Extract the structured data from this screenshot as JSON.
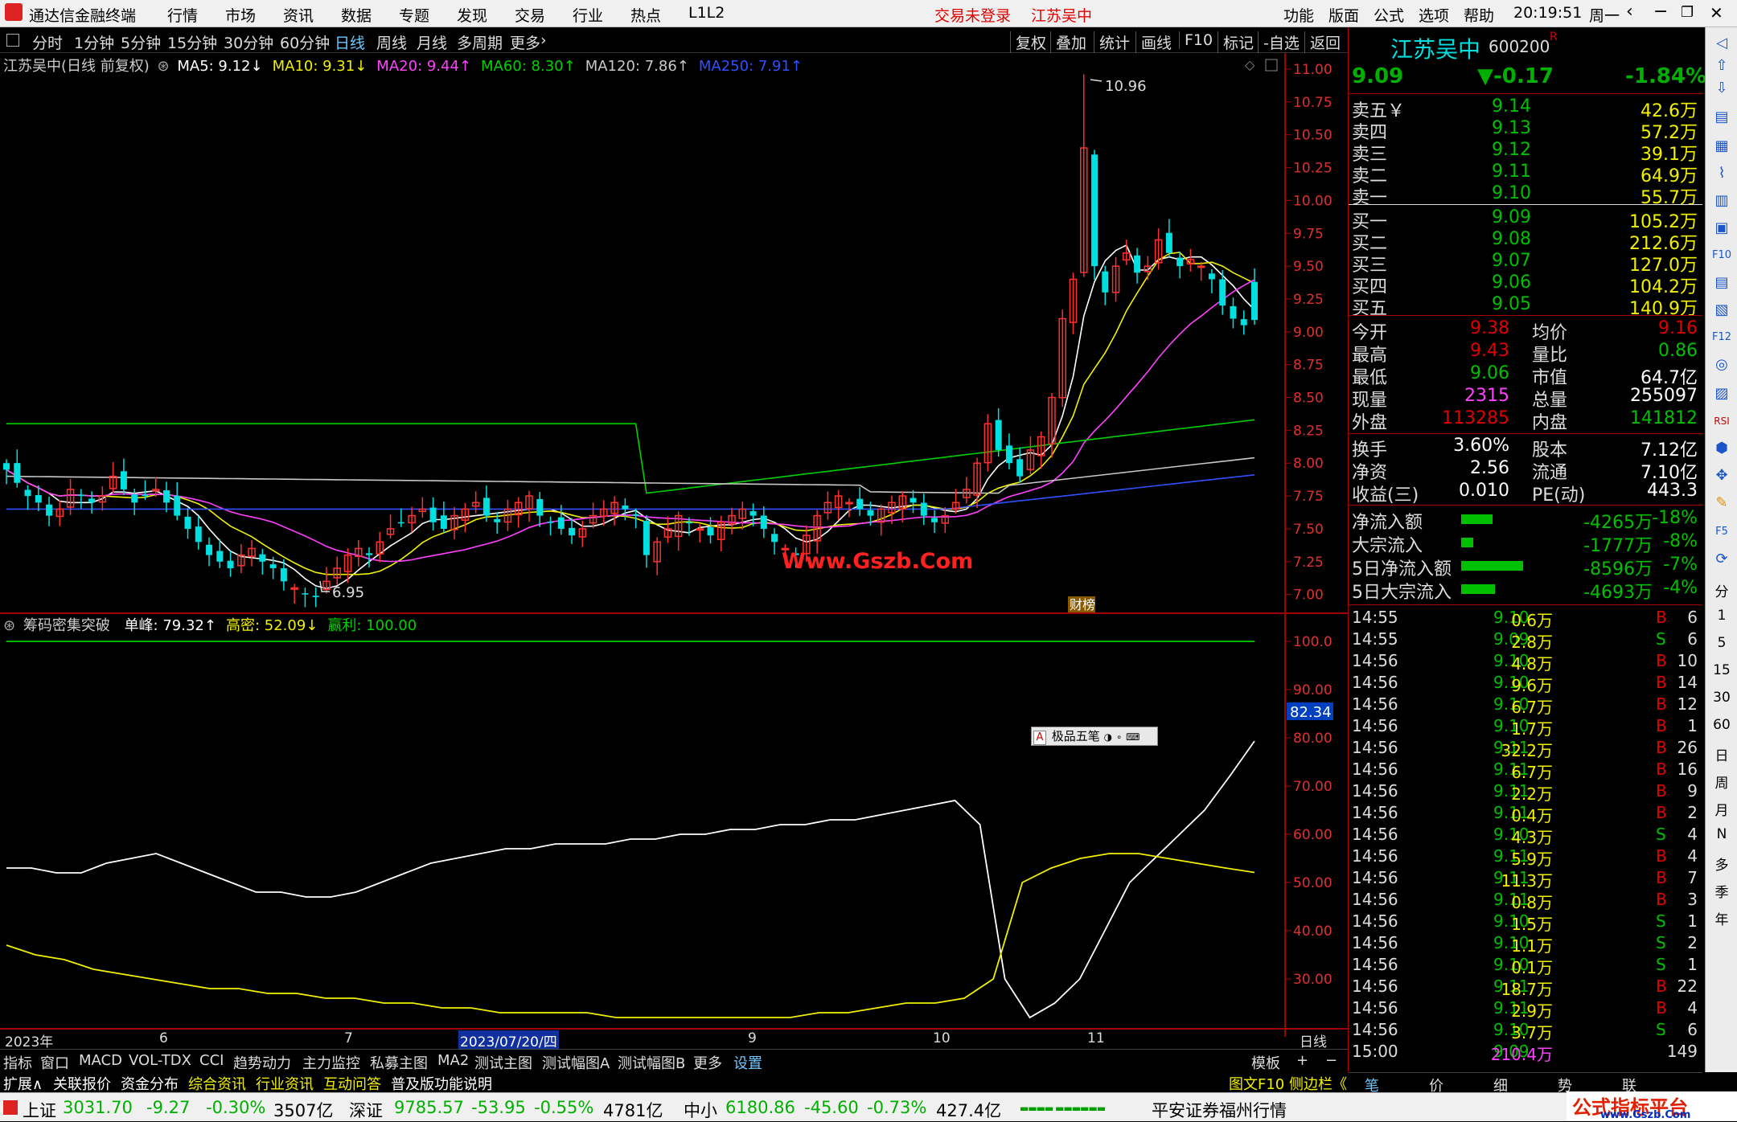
{
  "menubar": {
    "app_title": "通达信金融终端",
    "menus": [
      "行情",
      "市场",
      "资讯",
      "数据",
      "专题",
      "发现",
      "交易",
      "行业",
      "热点",
      "L1L2"
    ],
    "trade_status": "交易未登录",
    "stock_name": "江苏吴中",
    "right_menus": [
      "功能",
      "版面",
      "公式",
      "选项",
      "帮助"
    ],
    "time": "20:19:51",
    "weekday": "周一"
  },
  "period_bar": {
    "periods": [
      "分时",
      "1分钟",
      "5分钟",
      "15分钟",
      "30分钟",
      "60分钟",
      "日线",
      "周线",
      "月线",
      "多周期",
      "更多"
    ],
    "selected": "日线",
    "tools": [
      "复权",
      "叠加",
      "统计",
      "画线",
      "F10",
      "标记",
      "-自选",
      "返回"
    ]
  },
  "main_chart": {
    "title": "江苏吴中(日线 前复权)",
    "ma_labels": [
      {
        "text": "MA5: 9.12↓",
        "color": "#ffffff"
      },
      {
        "text": "MA10: 9.31↓",
        "color": "#f0f000"
      },
      {
        "text": "MA20: 9.44↑",
        "color": "#ff40ff"
      },
      {
        "text": "MA60: 8.30↑",
        "color": "#00d000"
      },
      {
        "text": "MA120: 7.86↑",
        "color": "#c8c8c8"
      },
      {
        "text": "MA250: 7.91↑",
        "color": "#3050ff"
      }
    ],
    "high_label": "10.96",
    "low_label": "6.95",
    "watermark": "Www.Gszb.Com",
    "caibang_label": "财榜",
    "y_ticks": [
      "11.00",
      "10.75",
      "10.50",
      "10.25",
      "10.00",
      "9.75",
      "9.50",
      "9.25",
      "9.00",
      "8.75",
      "8.50",
      "8.25",
      "8.00",
      "7.75",
      "7.50",
      "7.25",
      "7.00"
    ]
  },
  "indicator": {
    "name": "筹码密集突破",
    "labels": [
      {
        "text": "单峰: 79.32↑",
        "color": "#ffffff"
      },
      {
        "text": "高密: 52.09↓",
        "color": "#f0f000"
      },
      {
        "text": "赢利: 100.00",
        "color": "#00d000"
      }
    ],
    "current_value": "82.34",
    "ime_text": "极品五笔",
    "y_ticks": [
      "100.0",
      "90.00",
      "80.00",
      "70.00",
      "60.00",
      "50.00",
      "40.00",
      "30.00"
    ]
  },
  "x_axis": {
    "labels": [
      "2023年",
      "6",
      "7",
      "2023/07/20/四",
      "9",
      "10",
      "11"
    ],
    "right_label": "日线"
  },
  "chart_data": [
    {
      "type": "candlestick",
      "title": "江苏吴中(日线 前复权)",
      "x_range": [
        "2023-05",
        "2023-11"
      ],
      "ylim": [
        6.9,
        11.0
      ],
      "annotations": [
        {
          "label": "10.96",
          "kind": "high"
        },
        {
          "label": "6.95",
          "kind": "low"
        }
      ],
      "close_approx": [
        7.95,
        7.85,
        7.75,
        7.7,
        7.6,
        7.65,
        7.8,
        7.75,
        7.7,
        7.75,
        7.9,
        7.8,
        7.7,
        7.75,
        7.8,
        7.7,
        7.6,
        7.5,
        7.4,
        7.3,
        7.25,
        7.2,
        7.3,
        7.35,
        7.25,
        7.2,
        7.1,
        7.05,
        7.0,
        6.98,
        7.1,
        7.2,
        7.3,
        7.35,
        7.3,
        7.4,
        7.5,
        7.55,
        7.6,
        7.65,
        7.55,
        7.5,
        7.6,
        7.65,
        7.7,
        7.6,
        7.55,
        7.65,
        7.7,
        7.75,
        7.6,
        7.55,
        7.5,
        7.45,
        7.5,
        7.6,
        7.65,
        7.7,
        7.65,
        7.6,
        7.3,
        7.4,
        7.5,
        7.6,
        7.55,
        7.5,
        7.45,
        7.55,
        7.6,
        7.65,
        7.6,
        7.5,
        7.4,
        7.35,
        7.3,
        7.45,
        7.6,
        7.7,
        7.75,
        7.7,
        7.65,
        7.6,
        7.65,
        7.7,
        7.75,
        7.7,
        7.6,
        7.55,
        7.6,
        7.7,
        7.8,
        8.0,
        8.3,
        8.1,
        8.0,
        7.9,
        8.1,
        8.2,
        8.5,
        9.1,
        9.4,
        10.4,
        9.5,
        9.3,
        9.5,
        9.6,
        9.45,
        9.5,
        9.7,
        9.6,
        9.5,
        9.55,
        9.5,
        9.4,
        9.2,
        9.1,
        9.05,
        9.09
      ],
      "series": [
        {
          "name": "MA5",
          "last": 9.12
        },
        {
          "name": "MA10",
          "last": 9.31
        },
        {
          "name": "MA20",
          "last": 9.44
        },
        {
          "name": "MA60",
          "last": 8.3
        },
        {
          "name": "MA120",
          "last": 7.86
        },
        {
          "name": "MA250",
          "last": 7.91
        }
      ]
    },
    {
      "type": "line",
      "title": "筹码密集突破",
      "ylim": [
        20,
        102
      ],
      "series": [
        {
          "name": "单峰",
          "last": 79.32,
          "values": [
            53,
            53,
            52,
            52,
            54,
            55,
            56,
            54,
            52,
            50,
            48,
            48,
            47,
            47,
            48,
            50,
            52,
            54,
            55,
            56,
            57,
            57,
            58,
            58,
            58,
            59,
            59,
            60,
            60,
            61,
            61,
            62,
            62,
            63,
            63,
            64,
            65,
            66,
            67,
            62,
            30,
            22,
            25,
            30,
            40,
            50,
            55,
            60,
            65,
            72,
            79.32
          ]
        },
        {
          "name": "高密",
          "last": 52.09,
          "values": [
            37,
            35,
            34,
            32,
            31,
            30,
            29,
            28,
            28,
            27,
            27,
            26,
            26,
            25,
            25,
            24,
            24,
            23,
            23,
            23,
            23,
            22,
            22,
            22,
            22,
            22,
            22,
            22,
            23,
            23,
            24,
            25,
            25,
            26,
            30,
            50,
            53,
            55,
            56,
            56,
            55,
            54,
            53,
            52.09
          ]
        },
        {
          "name": "赢利",
          "last": 100.0,
          "values": [
            100,
            100
          ]
        }
      ]
    }
  ],
  "quote": {
    "name": "江苏吴中",
    "code": "600200",
    "flag": "R",
    "price": "9.09",
    "change": "▼-0.17",
    "pct": "-1.84%",
    "asks": [
      {
        "label": "卖五￥",
        "price": "9.14",
        "vol": "42.6万"
      },
      {
        "label": "卖四",
        "price": "9.13",
        "vol": "57.2万"
      },
      {
        "label": "卖三",
        "price": "9.12",
        "vol": "39.1万"
      },
      {
        "label": "卖二",
        "price": "9.11",
        "vol": "64.9万"
      },
      {
        "label": "卖一",
        "price": "9.10",
        "vol": "55.7万"
      }
    ],
    "bids": [
      {
        "label": "买一",
        "price": "9.09",
        "vol": "105.2万"
      },
      {
        "label": "买二",
        "price": "9.08",
        "vol": "212.6万"
      },
      {
        "label": "买三",
        "price": "9.07",
        "vol": "127.0万"
      },
      {
        "label": "买四",
        "price": "9.06",
        "vol": "104.2万"
      },
      {
        "label": "买五",
        "price": "9.05",
        "vol": "140.9万"
      }
    ],
    "stats": [
      {
        "l1": "今开",
        "v1": "9.38",
        "c1": "#e00000",
        "l2": "均价",
        "v2": "9.16",
        "c2": "#e00000"
      },
      {
        "l1": "最高",
        "v1": "9.43",
        "c1": "#e00000",
        "l2": "量比",
        "v2": "0.86",
        "c2": "#00c000"
      },
      {
        "l1": "最低",
        "v1": "9.06",
        "c1": "#00c000",
        "l2": "市值",
        "v2": "64.7亿",
        "c2": "#ffffff"
      },
      {
        "l1": "现量",
        "v1": "2315",
        "c1": "#ff40ff",
        "l2": "总量",
        "v2": "255097",
        "c2": "#ffffff"
      },
      {
        "l1": "外盘",
        "v1": "113285",
        "c1": "#e00000",
        "l2": "内盘",
        "v2": "141812",
        "c2": "#00c000"
      }
    ],
    "stats2": [
      {
        "l1": "换手",
        "v1": "3.60%",
        "l2": "股本",
        "v2": "7.12亿"
      },
      {
        "l1": "净资",
        "v1": "2.56",
        "l2": "流通",
        "v2": "7.10亿"
      },
      {
        "l1": "收益(三)",
        "v1": "0.010",
        "l2": "PE(动)",
        "v2": "443.3"
      }
    ],
    "flows": [
      {
        "label": "净流入额",
        "value": "-4265万",
        "pct": "-18%",
        "bar": 0.35
      },
      {
        "label": "大宗流入",
        "value": "-1777万",
        "pct": "-8%",
        "bar": 0.14
      },
      {
        "label": "5日净流入额",
        "value": "-8596万",
        "pct": "-7%",
        "bar": 0.7
      },
      {
        "label": "5日大宗流入",
        "value": "-4693万",
        "pct": "-4%",
        "bar": 0.38
      }
    ]
  },
  "ticks": [
    {
      "t": "14:55",
      "p": "9.10",
      "v": "0.6万",
      "d": "B",
      "n": "6"
    },
    {
      "t": "14:55",
      "p": "9.09",
      "v": "2.8万",
      "d": "S",
      "n": "6"
    },
    {
      "t": "14:56",
      "p": "9.10",
      "v": "4.8万",
      "d": "B",
      "n": "10"
    },
    {
      "t": "14:56",
      "p": "9.10",
      "v": "9.6万",
      "d": "B",
      "n": "14"
    },
    {
      "t": "14:56",
      "p": "9.10",
      "v": "6.7万",
      "d": "B",
      "n": "12"
    },
    {
      "t": "14:56",
      "p": "9.10",
      "v": "1.7万",
      "d": "B",
      "n": "1"
    },
    {
      "t": "14:56",
      "p": "9.11",
      "v": "32.2万",
      "d": "B",
      "n": "26"
    },
    {
      "t": "14:56",
      "p": "9.11",
      "v": "6.7万",
      "d": "B",
      "n": "16"
    },
    {
      "t": "14:56",
      "p": "9.11",
      "v": "2.2万",
      "d": "B",
      "n": "9"
    },
    {
      "t": "14:56",
      "p": "9.11",
      "v": "0.4万",
      "d": "B",
      "n": "2"
    },
    {
      "t": "14:56",
      "p": "9.10",
      "v": "4.3万",
      "d": "S",
      "n": "4"
    },
    {
      "t": "14:56",
      "p": "9.11",
      "v": "5.9万",
      "d": "B",
      "n": "4"
    },
    {
      "t": "14:56",
      "p": "9.11",
      "v": "11.3万",
      "d": "B",
      "n": "7"
    },
    {
      "t": "14:56",
      "p": "9.11",
      "v": "0.8万",
      "d": "B",
      "n": "3"
    },
    {
      "t": "14:56",
      "p": "9.10",
      "v": "1.5万",
      "d": "S",
      "n": "1"
    },
    {
      "t": "14:56",
      "p": "9.10",
      "v": "1.1万",
      "d": "S",
      "n": "2"
    },
    {
      "t": "14:56",
      "p": "9.10",
      "v": "0.1万",
      "d": "S",
      "n": "1"
    },
    {
      "t": "14:56",
      "p": "9.11",
      "v": "18.7万",
      "d": "B",
      "n": "22"
    },
    {
      "t": "14:56",
      "p": "9.11",
      "v": "2.9万",
      "d": "B",
      "n": "4"
    },
    {
      "t": "14:56",
      "p": "9.10",
      "v": "3.7万",
      "d": "S",
      "n": "6"
    },
    {
      "t": "15:00",
      "p": "9.09",
      "v": "210.4万",
      "d": "",
      "n": "149"
    }
  ],
  "bottom_tabs": [
    "指标",
    "窗口",
    "MACD",
    "VOL-TDX",
    "CCI",
    "趋势动力",
    "主力监控",
    "私募主图",
    "MA2",
    "测试主图",
    "测试幅图A",
    "测试幅图B",
    "更多",
    "设置"
  ],
  "bottom_right": [
    "模板",
    "+",
    "−"
  ],
  "bottom_tabs2": [
    {
      "text": "扩展∧",
      "color": "#ffffff"
    },
    {
      "text": "关联报价",
      "color": "#ffffff"
    },
    {
      "text": "资金分布",
      "color": "#ffffff"
    },
    {
      "text": "综合资讯",
      "color": "#f0f000"
    },
    {
      "text": "行业资讯",
      "color": "#f0f000"
    },
    {
      "text": "互动问答",
      "color": "#f0f000"
    },
    {
      "text": "普及版功能说明",
      "color": "#ffffff"
    }
  ],
  "bottom_right2": "图文F10 侧边栏《",
  "right_tabs": [
    "笔",
    "价",
    "细",
    "势",
    "联"
  ],
  "status": {
    "sh_name": "上证",
    "sh_val": "3031.70",
    "sh_chg": "-9.27",
    "sh_pct": "-0.30%",
    "sh_amt": "3507亿",
    "sz_name": "深证",
    "sz_val": "9785.57",
    "sz_chg": "-53.95",
    "sz_pct": "-0.55%",
    "sz_amt": "4781亿",
    "zx_name": "中小",
    "zx_val": "6180.86",
    "zx_chg": "-45.60",
    "zx_pct": "-0.73%",
    "zx_amt": "427.4亿",
    "broker": "平安证券福州行情",
    "site": "公式指标平台",
    "site_url": "www.Gszb.Com"
  },
  "sidebar_labels": [
    "分",
    "1",
    "5",
    "15",
    "30",
    "60",
    "日",
    "周",
    "月",
    "N",
    "多",
    "季",
    "年"
  ],
  "colors": {
    "up": "#ff3030",
    "down": "#00e0e0",
    "accent": "#e00000",
    "axis_border": "#a00000"
  }
}
